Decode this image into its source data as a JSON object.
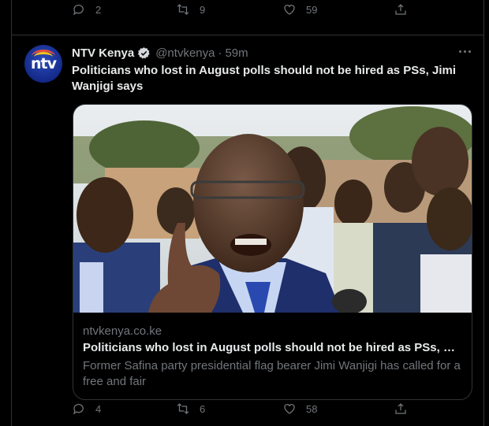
{
  "prev_tweet": {
    "reply_count": "2",
    "retweet_count": "9",
    "like_count": "59"
  },
  "tweet": {
    "author_name": "NTV Kenya",
    "handle": "@ntvkenya",
    "separator": "·",
    "time": "59m",
    "text": "Politicians who lost in August polls should not be hired as PSs, Jimi Wanjigi says",
    "avatar_logo": "ntv",
    "card": {
      "domain": "ntvkenya.co.ke",
      "title": "Politicians who lost in August polls should not be hired as PSs, Jimi W...",
      "description": "Former Safina party presidential flag bearer Jimi Wanjigi has called for a free and fair"
    },
    "reply_count": "4",
    "retweet_count": "6",
    "like_count": "58"
  },
  "icons": [
    "reply-icon",
    "retweet-icon",
    "like-icon",
    "share-icon",
    "verified-badge-icon",
    "more-options-icon"
  ],
  "colors": {
    "background": "#000000",
    "text": "#e7e9ea",
    "muted": "#71767b",
    "border": "#2f3336",
    "verified": "#d6d9db"
  }
}
